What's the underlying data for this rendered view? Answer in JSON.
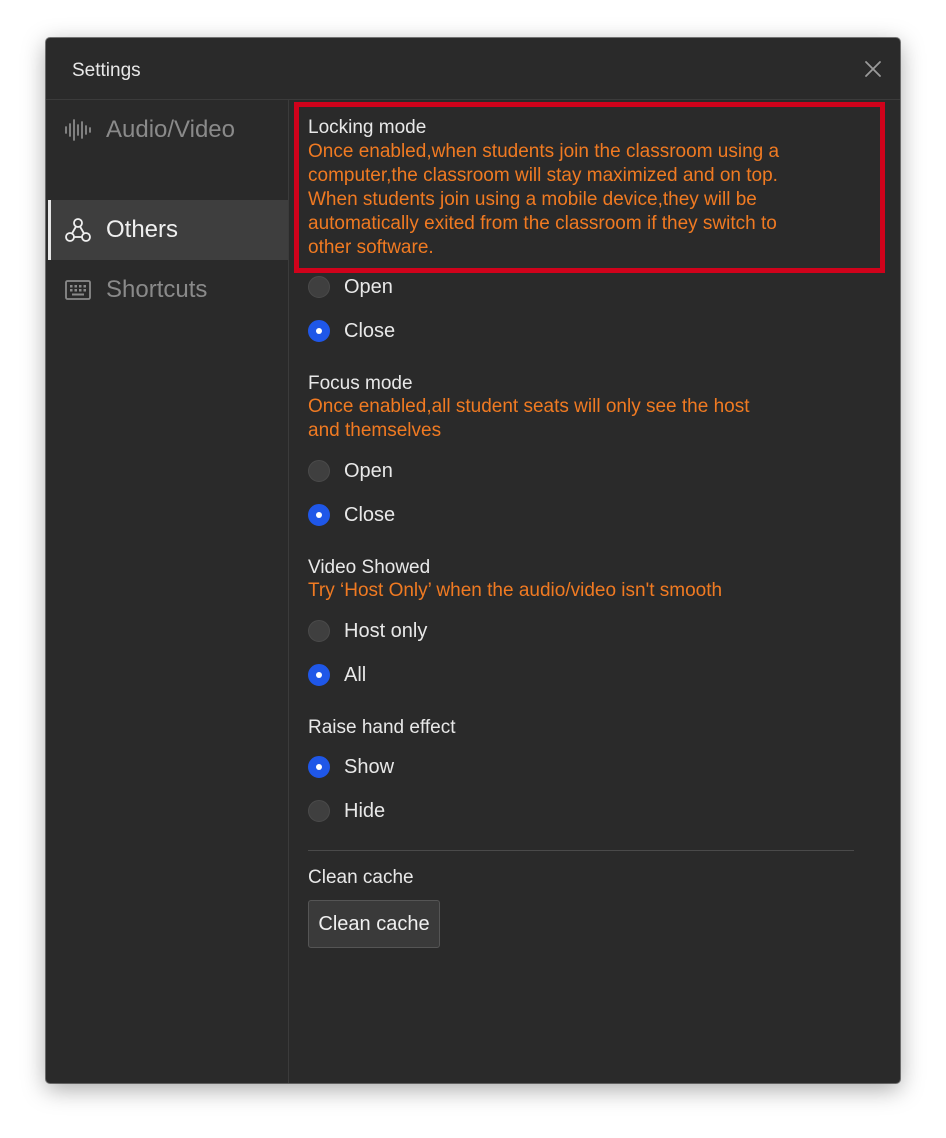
{
  "window": {
    "title": "Settings"
  },
  "sidebar": {
    "items": [
      {
        "label": "Audio/Video",
        "icon": "audio-wave-icon",
        "active": false
      },
      {
        "label": "Others",
        "icon": "network-nodes-icon",
        "active": true
      },
      {
        "label": "Shortcuts",
        "icon": "keyboard-icon",
        "active": false
      }
    ]
  },
  "locking": {
    "heading": "Locking mode",
    "desc_lines": [
      "Once enabled,when students join the classroom using a",
      "computer,the classroom will stay maximized and on top.",
      "When students join using a mobile device,they will be",
      "automatically exited from the classroom if they switch to",
      "other software."
    ],
    "options": [
      {
        "label": "Open",
        "checked": false
      },
      {
        "label": "Close",
        "checked": true
      }
    ]
  },
  "focus": {
    "heading": "Focus mode",
    "desc_lines": [
      "Once enabled,all student seats will only see the host",
      "and themselves"
    ],
    "options": [
      {
        "label": "Open",
        "checked": false
      },
      {
        "label": "Close",
        "checked": true
      }
    ]
  },
  "video": {
    "heading": "Video Showed",
    "desc_lines": [
      "Try ‘Host Only’ when the audio/video isn't smooth"
    ],
    "options": [
      {
        "label": "Host only",
        "checked": false
      },
      {
        "label": "All",
        "checked": true
      }
    ]
  },
  "raise_hand": {
    "heading": "Raise hand effect",
    "options": [
      {
        "label": "Show",
        "checked": true
      },
      {
        "label": "Hide",
        "checked": false
      }
    ]
  },
  "cache": {
    "heading": "Clean cache",
    "button_label": "Clean cache"
  },
  "colors": {
    "accent": "#1f57e8",
    "warning_text": "#f07a22",
    "highlight_border": "#d0021b"
  }
}
